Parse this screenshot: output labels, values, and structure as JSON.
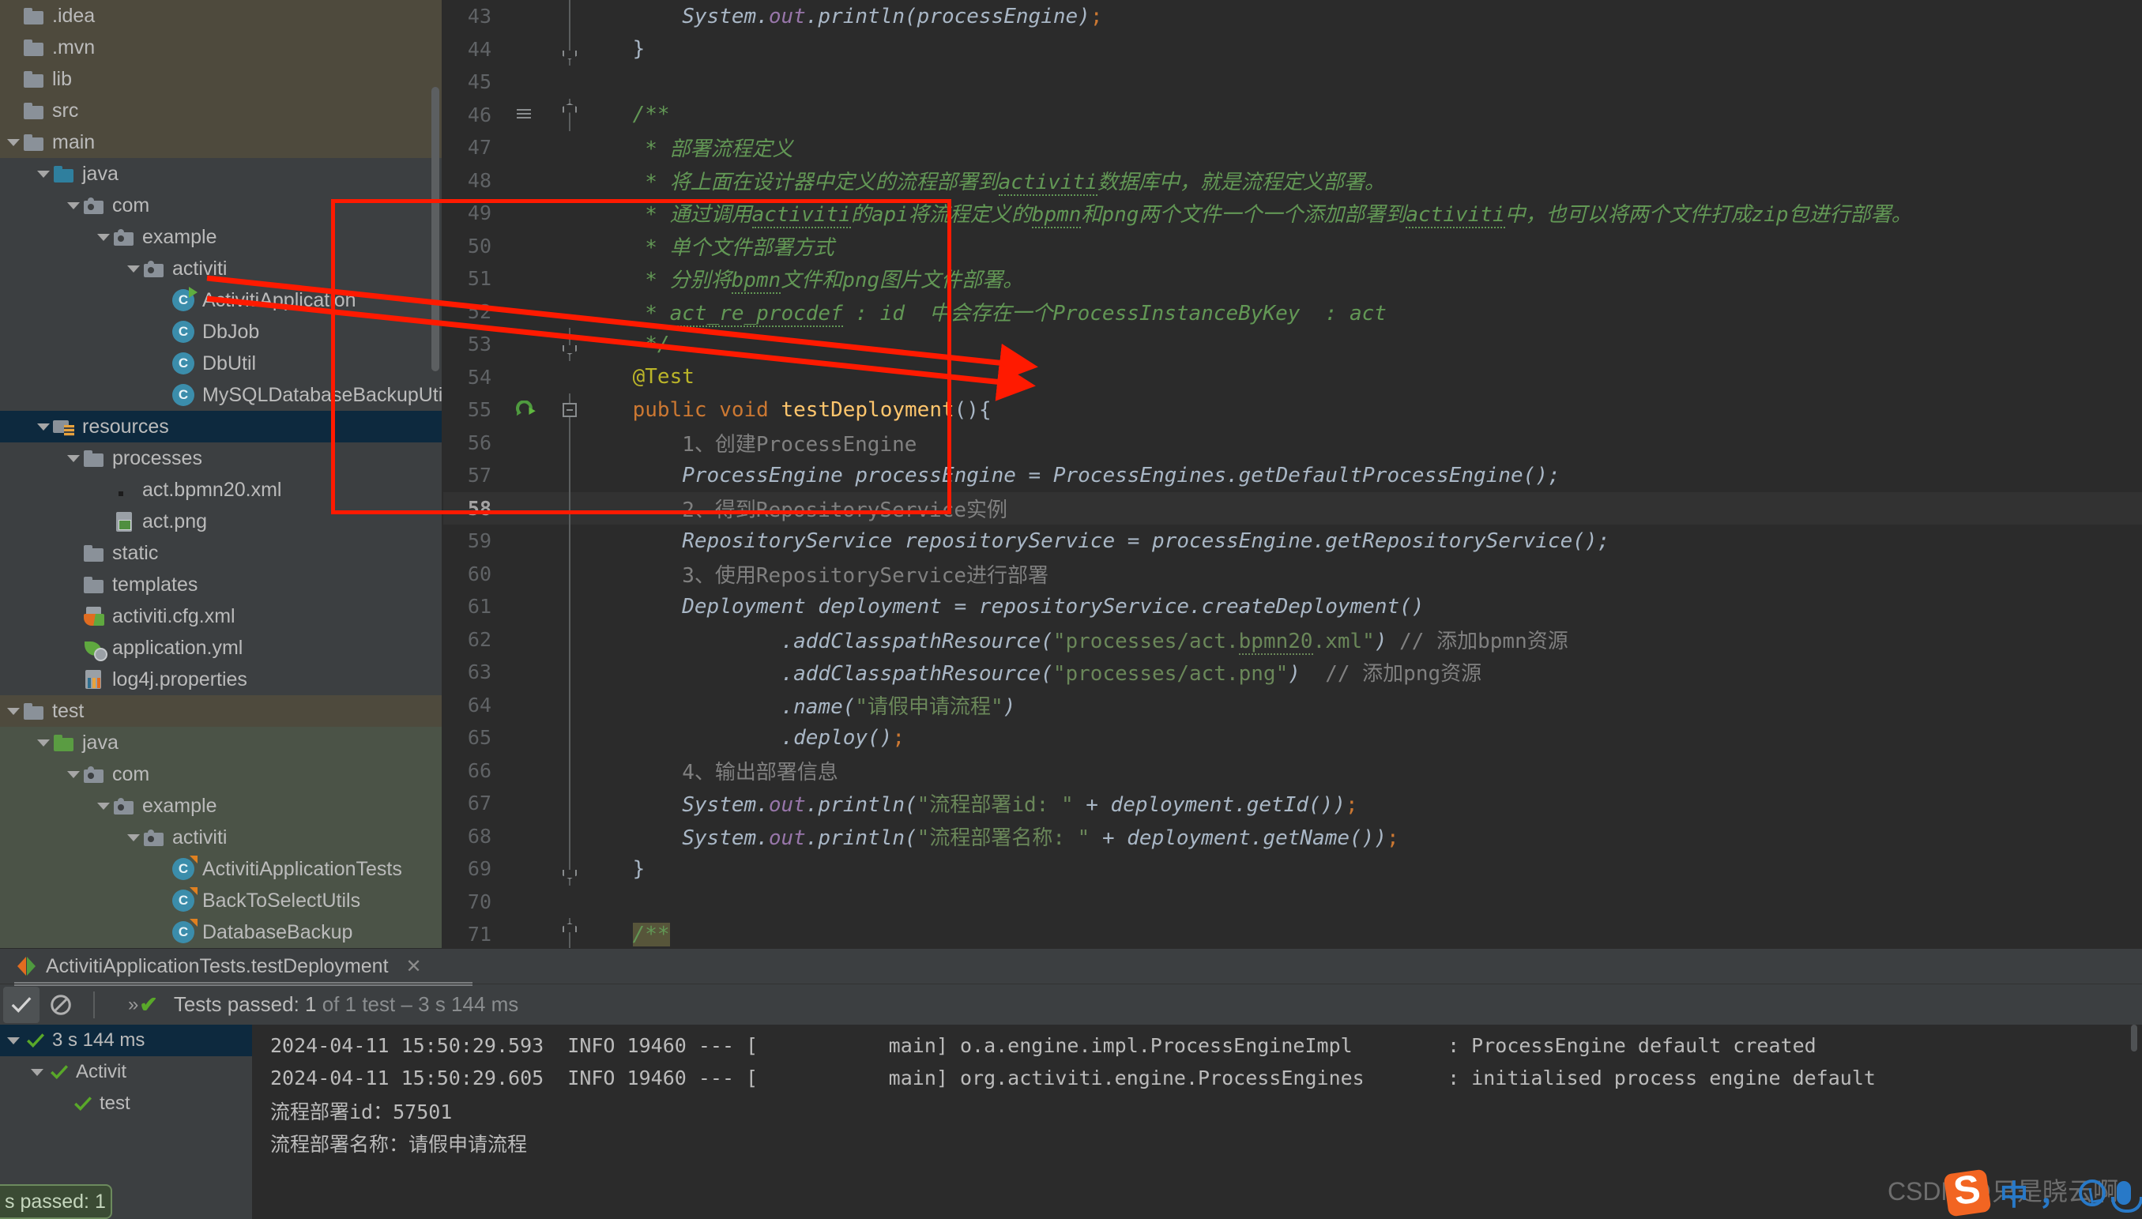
{
  "project_tree": {
    "items": [
      {
        "label": ".idea",
        "indent": 0,
        "icon": "folder",
        "arrow": false,
        "tint": "main"
      },
      {
        "label": ".mvn",
        "indent": 0,
        "icon": "folder",
        "arrow": false,
        "tint": "main"
      },
      {
        "label": "lib",
        "indent": 0,
        "icon": "folder",
        "arrow": false,
        "tint": "main"
      },
      {
        "label": "src",
        "indent": 0,
        "icon": "folder",
        "arrow": false,
        "tint": "main"
      },
      {
        "label": "main",
        "indent": 0,
        "icon": "folder",
        "arrow": true,
        "tint": "main"
      },
      {
        "label": "java",
        "indent": 1,
        "icon": "folder-blue",
        "arrow": true,
        "tint": "java"
      },
      {
        "label": "com",
        "indent": 2,
        "icon": "pkg",
        "arrow": true,
        "tint": "java"
      },
      {
        "label": "example",
        "indent": 3,
        "icon": "pkg",
        "arrow": true,
        "tint": "java"
      },
      {
        "label": "activiti",
        "indent": 4,
        "icon": "pkg",
        "arrow": true,
        "tint": "java"
      },
      {
        "label": "ActivitiApplication",
        "indent": 5,
        "icon": "cls-run",
        "arrow": false,
        "tint": "java"
      },
      {
        "label": "DbJob",
        "indent": 5,
        "icon": "cls",
        "arrow": false,
        "tint": "java"
      },
      {
        "label": "DbUtil",
        "indent": 5,
        "icon": "cls",
        "arrow": false,
        "tint": "java"
      },
      {
        "label": "MySQLDatabaseBackupUti",
        "indent": 5,
        "icon": "cls",
        "arrow": false,
        "tint": "java"
      },
      {
        "label": "resources",
        "indent": 1,
        "icon": "res",
        "arrow": true,
        "tint": "sel"
      },
      {
        "label": "processes",
        "indent": 2,
        "icon": "folder",
        "arrow": true,
        "tint": "java"
      },
      {
        "label": "act.bpmn20.xml",
        "indent": 3,
        "icon": "dot",
        "arrow": false,
        "tint": "java"
      },
      {
        "label": "act.png",
        "indent": 3,
        "icon": "png",
        "arrow": false,
        "tint": "java"
      },
      {
        "label": "static",
        "indent": 2,
        "icon": "folder",
        "arrow": false,
        "tint": "java"
      },
      {
        "label": "templates",
        "indent": 2,
        "icon": "folder",
        "arrow": false,
        "tint": "java"
      },
      {
        "label": "activiti.cfg.xml",
        "indent": 2,
        "icon": "springxml",
        "arrow": false,
        "tint": "java"
      },
      {
        "label": "application.yml",
        "indent": 2,
        "icon": "spring",
        "arrow": false,
        "tint": "java"
      },
      {
        "label": "log4j.properties",
        "indent": 2,
        "icon": "props",
        "arrow": false,
        "tint": "java"
      },
      {
        "label": "test",
        "indent": 0,
        "icon": "folder",
        "arrow": true,
        "tint": "test"
      },
      {
        "label": "java",
        "indent": 1,
        "icon": "folder-green",
        "arrow": true,
        "tint": "tjava"
      },
      {
        "label": "com",
        "indent": 2,
        "icon": "pkg",
        "arrow": true,
        "tint": "tjava"
      },
      {
        "label": "example",
        "indent": 3,
        "icon": "pkg",
        "arrow": true,
        "tint": "tjava"
      },
      {
        "label": "activiti",
        "indent": 4,
        "icon": "pkg",
        "arrow": true,
        "tint": "tjava"
      },
      {
        "label": "ActivitiApplicationTests",
        "indent": 5,
        "icon": "cls-test",
        "arrow": false,
        "tint": "tjava"
      },
      {
        "label": "BackToSelectUtils",
        "indent": 5,
        "icon": "cls-test",
        "arrow": false,
        "tint": "tjava"
      },
      {
        "label": "DatabaseBackup",
        "indent": 5,
        "icon": "cls-test",
        "arrow": false,
        "tint": "tjava"
      }
    ]
  },
  "editor": {
    "lines": [
      {
        "no": "43",
        "fold": "vline",
        "doc": false,
        "run": false,
        "current": false,
        "html": "        <span class='sta'>System.</span><span class='fld'>out</span><span class='sta'>.println(processEngine)</span><span class='semi'>;</span>"
      },
      {
        "no": "44",
        "fold": "capbot",
        "doc": false,
        "run": false,
        "current": false,
        "html": "    }"
      },
      {
        "no": "45",
        "fold": "none",
        "doc": false,
        "run": false,
        "current": false,
        "html": ""
      },
      {
        "no": "46",
        "fold": "captop",
        "doc": true,
        "run": false,
        "current": false,
        "html": "    <span class='cmt'>/**</span>"
      },
      {
        "no": "47",
        "fold": "none",
        "doc": false,
        "run": false,
        "current": false,
        "html": "     <span class='cmt'>* 部署流程定义</span>"
      },
      {
        "no": "48",
        "fold": "none",
        "doc": false,
        "run": false,
        "current": false,
        "html": "     <span class='cmt'>* 将上面在设计器中定义的流程部署到<span class='wavy'>activiti</span>数据库中，就是流程定义部署。</span>"
      },
      {
        "no": "49",
        "fold": "none",
        "doc": false,
        "run": false,
        "current": false,
        "html": "     <span class='cmt'>* 通过调用<span class='wavy'>activiti</span>的api将流程定义的<span class='wavy'>bpmn</span>和png两个文件一个一个添加部署到<span class='wavy'>activiti</span>中，也可以将两个文件打成zip包进行部署。</span>"
      },
      {
        "no": "50",
        "fold": "none",
        "doc": false,
        "run": false,
        "current": false,
        "html": "     <span class='cmt'>* 单个文件部署方式</span>"
      },
      {
        "no": "51",
        "fold": "none",
        "doc": false,
        "run": false,
        "current": false,
        "html": "     <span class='cmt'>* 分别将<span class='wavy'>bpmn</span>文件和png图片文件部署。</span>"
      },
      {
        "no": "52",
        "fold": "none",
        "doc": false,
        "run": false,
        "current": false,
        "html": "     <span class='cmt'>* <span class='wavy'>act_re_procdef</span> : id  中会存在一个ProcessInstanceByKey  : act</span>"
      },
      {
        "no": "53",
        "fold": "capbot",
        "doc": false,
        "run": false,
        "current": false,
        "html": "     <span class='cmt'>*/</span>"
      },
      {
        "no": "54",
        "fold": "none",
        "doc": false,
        "run": false,
        "current": false,
        "html": "    <span class='ann'>@Test</span>"
      },
      {
        "no": "55",
        "fold": "mid",
        "doc": false,
        "run": true,
        "current": false,
        "html": "    <span class='kw'>public</span> <span class='kw'>void</span> <span class='fn'>testDeployment</span>(){"
      },
      {
        "no": "56",
        "fold": "vline",
        "doc": false,
        "run": false,
        "current": false,
        "slash": true,
        "html": "        <span class='cmt-plain'>1、创建ProcessEngine</span>"
      },
      {
        "no": "57",
        "fold": "vline",
        "doc": false,
        "run": false,
        "current": false,
        "html": "        <span class='sta'>ProcessEngine processEngine = ProcessEngines.</span><span class='sta' style='font-style:italic'>getDefaultProcessEngine</span><span class='sta'>();</span>"
      },
      {
        "no": "58",
        "fold": "vline",
        "doc": false,
        "run": false,
        "current": true,
        "slash": true,
        "html": "        <span class='cmt-plain'>2、得到RepositoryService实例</span>"
      },
      {
        "no": "59",
        "fold": "vline",
        "doc": false,
        "run": false,
        "current": false,
        "html": "        <span class='sta'>RepositoryService repositoryService = processEngine.getRepositoryService();</span>"
      },
      {
        "no": "60",
        "fold": "vline",
        "doc": false,
        "run": false,
        "current": false,
        "slash": true,
        "html": "        <span class='cmt-plain'>3、使用RepositoryService进行部署</span>"
      },
      {
        "no": "61",
        "fold": "vline",
        "doc": false,
        "run": false,
        "current": false,
        "html": "        <span class='sta'>Deployment deployment = repositoryService.createDeployment()</span>"
      },
      {
        "no": "62",
        "fold": "vline",
        "doc": false,
        "run": false,
        "current": false,
        "html": "                <span class='sta'>.addClasspathResource(</span><span class='str'>\"processes/act.<span class='wavy' style='border-color:#6a8759'>bpmn20</span>.xml\"</span><span class='sta'>) </span><span class='cmt-plain'>// 添加bpmn资源</span>"
      },
      {
        "no": "63",
        "fold": "vline",
        "doc": false,
        "run": false,
        "current": false,
        "html": "                <span class='sta'>.addClasspathResource(</span><span class='str'>\"processes/act.png\"</span><span class='sta'>)  </span><span class='cmt-plain'>// 添加png资源</span>"
      },
      {
        "no": "64",
        "fold": "vline",
        "doc": false,
        "run": false,
        "current": false,
        "html": "                <span class='sta'>.name(</span><span class='str'>\"请假申请流程\"</span><span class='sta'>)</span>"
      },
      {
        "no": "65",
        "fold": "vline",
        "doc": false,
        "run": false,
        "current": false,
        "html": "                <span class='sta'>.deploy()</span><span class='semi'>;</span>"
      },
      {
        "no": "66",
        "fold": "vline",
        "doc": false,
        "run": false,
        "current": false,
        "slash": true,
        "html": "        <span class='cmt-plain'>4、输出部署信息</span>"
      },
      {
        "no": "67",
        "fold": "vline",
        "doc": false,
        "run": false,
        "current": false,
        "html": "        <span class='sta'>System.</span><span class='fld'>out</span><span class='sta'>.println(</span><span class='str'>\"流程部署id: \"</span><span class='sta'> + deployment.getId())</span><span class='semi'>;</span>"
      },
      {
        "no": "68",
        "fold": "vline",
        "doc": false,
        "run": false,
        "current": false,
        "html": "        <span class='sta'>System.</span><span class='fld'>out</span><span class='sta'>.println(</span><span class='str'>\"流程部署名称: \"</span><span class='sta'> + deployment.getName())</span><span class='semi'>;</span>"
      },
      {
        "no": "69",
        "fold": "capbot",
        "doc": false,
        "run": false,
        "current": false,
        "html": "    }"
      },
      {
        "no": "70",
        "fold": "none",
        "doc": false,
        "run": false,
        "current": false,
        "html": ""
      },
      {
        "no": "71",
        "fold": "captop",
        "doc": false,
        "run": false,
        "current": false,
        "html": "    <span class='cmt hl-match'>/**</span>"
      }
    ]
  },
  "run_panel": {
    "tab_label": "ActivitiApplicationTests.testDeployment",
    "tab_close": "✕",
    "chevron": "»",
    "status_prefix": "Tests passed: ",
    "status_count": "1",
    "status_suffix": " of 1 test – 3 s 144 ms",
    "test_tree": [
      {
        "label": "3 s 144 ms",
        "indent": 0,
        "arrow": true,
        "selected": true
      },
      {
        "label": "Activit",
        "indent": 1,
        "arrow": true,
        "selected": false
      },
      {
        "label": "test",
        "indent": 2,
        "arrow": false,
        "selected": false
      }
    ],
    "console_lines": [
      "2024-04-11 15:50:29.593  INFO 19460 --- [           main] o.a.engine.impl.ProcessEngineImpl        : ProcessEngine default created",
      "2024-04-11 15:50:29.605  INFO 19460 --- [           main] org.activiti.engine.ProcessEngines       : initialised process engine default",
      "流程部署id：57501",
      "流程部署名称：请假申请流程"
    ]
  },
  "toast": {
    "text": "s passed: 1"
  },
  "watermark": {
    "text": "CSDN @只是晓云啊"
  },
  "colors": {
    "accent_red": "#ff1a00",
    "editor_bg": "#2b2b2b",
    "panel_bg": "#3c3f41",
    "selection_blue": "#0d293e",
    "string_green": "#6a8759",
    "comment_green": "#629755",
    "keyword_orange": "#cc7832"
  }
}
